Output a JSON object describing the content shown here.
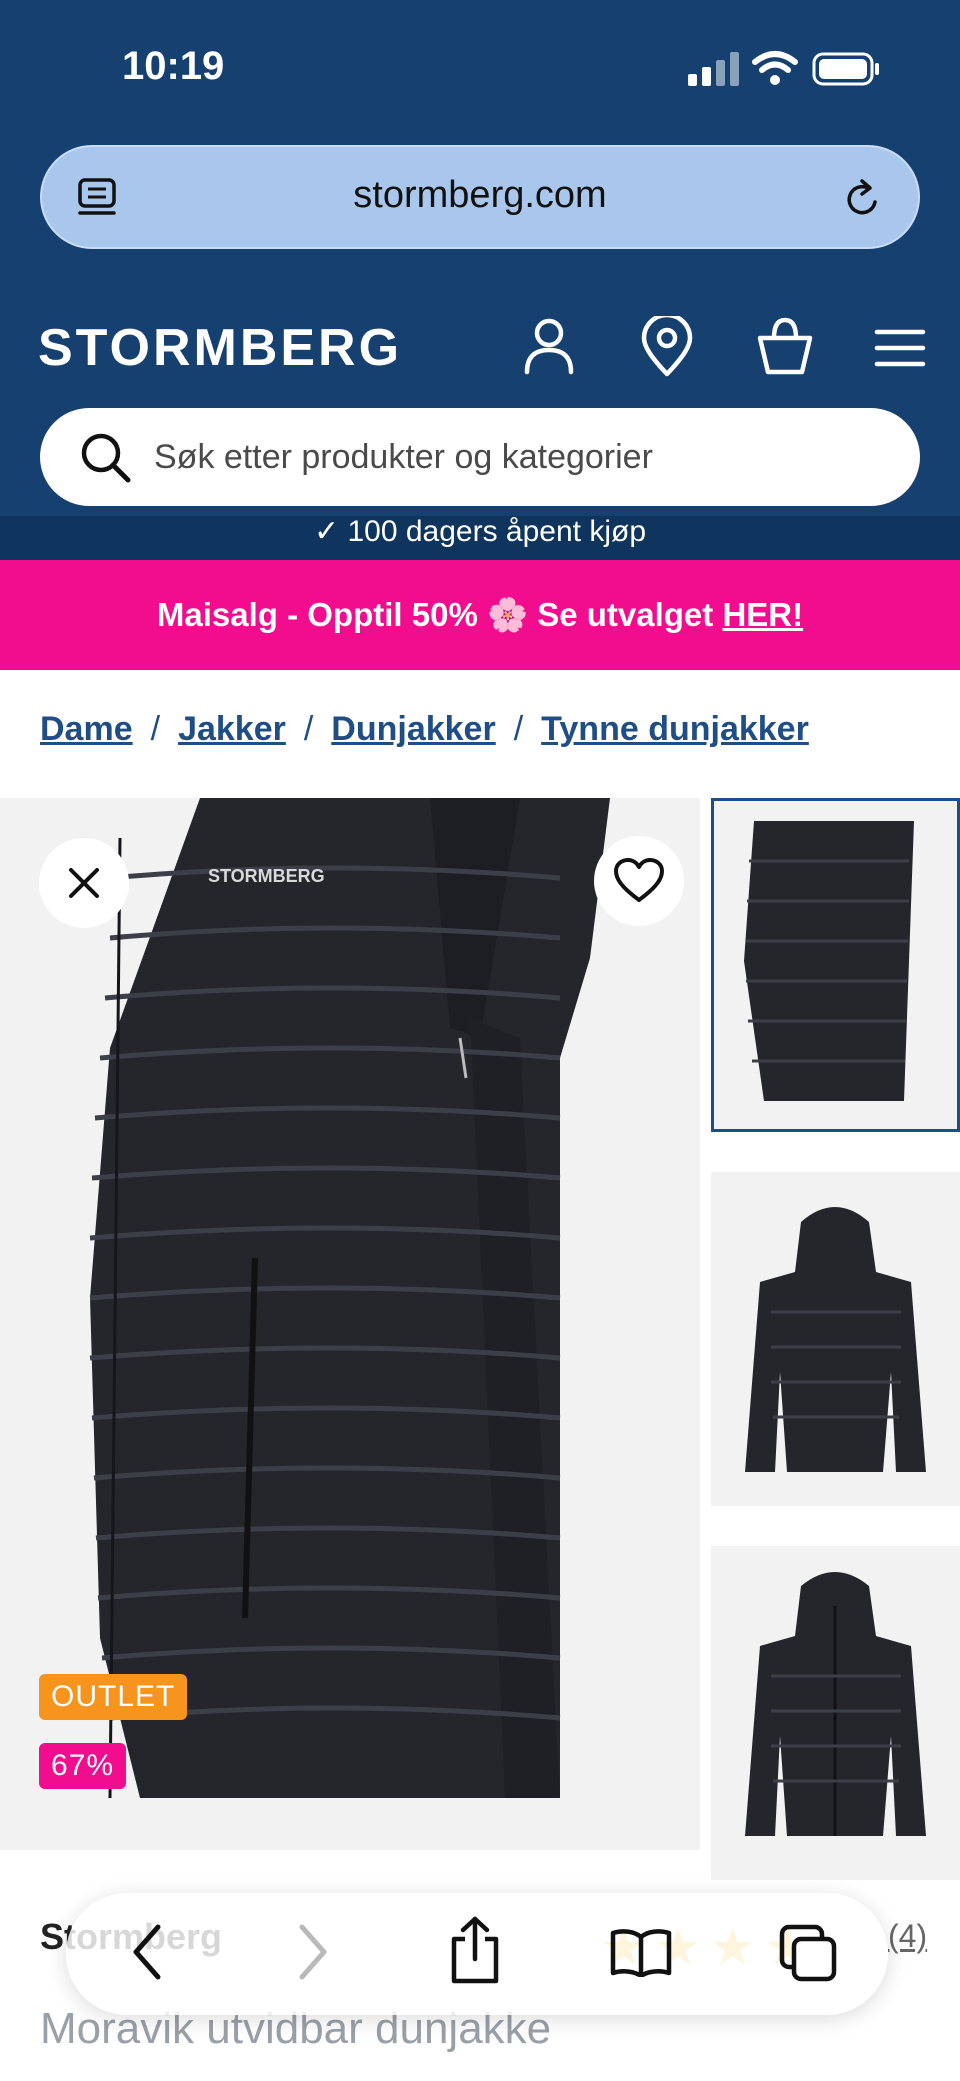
{
  "status_bar": {
    "time": "10:19"
  },
  "browser": {
    "url": "stormberg.com"
  },
  "site": {
    "logo_text": "STORMBERG",
    "search_placeholder": "Søk etter produkter og kategorier",
    "usp_text": "100 dagers åpent kjøp"
  },
  "promo": {
    "text": "Maisalg - Opptil 50% 🌸 Se utvalget ",
    "link": "HER!"
  },
  "breadcrumb": [
    "Dame",
    "Jakker",
    "Dunjakker",
    "Tynne dunjakker"
  ],
  "gallery": {
    "badges": {
      "outlet": "OUTLET",
      "discount": "67%"
    }
  },
  "product": {
    "brand": "Stormberg",
    "title": "Moravik utvidbar dunjakke",
    "review_count": "(4)"
  },
  "colors": {
    "header_bg": "#16406f",
    "promo_pink": "#f20d8e",
    "outlet_orange": "#f7941d",
    "link_blue": "#1f4e86"
  }
}
